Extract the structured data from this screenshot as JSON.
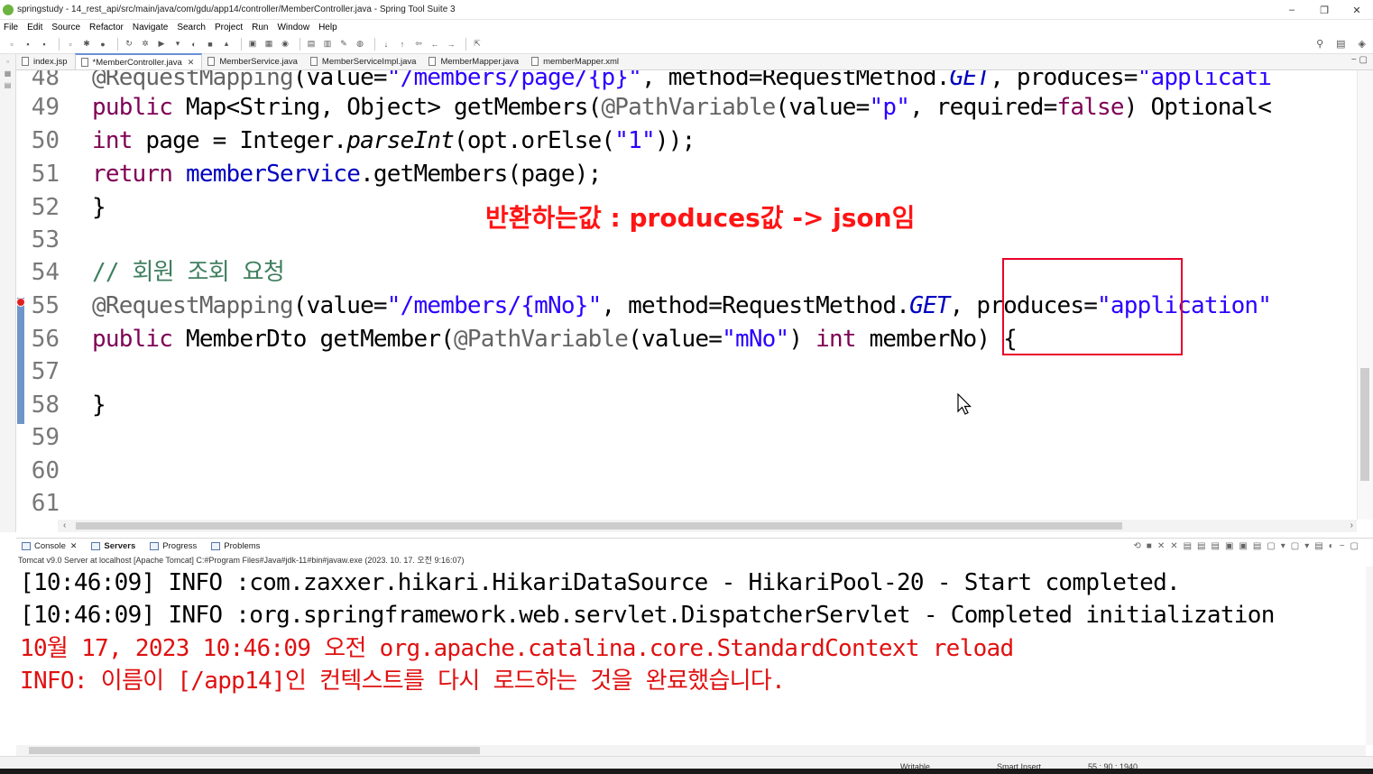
{
  "window": {
    "title": "springstudy - 14_rest_api/src/main/java/com/gdu/app14/controller/MemberController.java - Spring Tool Suite 3",
    "minimize": "–",
    "restore": "❐",
    "close": "✕"
  },
  "menu": [
    "File",
    "Edit",
    "Source",
    "Refactor",
    "Navigate",
    "Search",
    "Project",
    "Run",
    "Window",
    "Help"
  ],
  "editor_tabs": [
    {
      "label": "index.jsp",
      "active": false
    },
    {
      "label": "*MemberController.java",
      "active": true
    },
    {
      "label": "MemberService.java",
      "active": false
    },
    {
      "label": "MemberServiceImpl.java",
      "active": false
    },
    {
      "label": "MemberMapper.java",
      "active": false
    },
    {
      "label": "memberMapper.xml",
      "active": false
    }
  ],
  "code_lines": [
    {
      "num": "48",
      "text": "@RequestMapping(value=\"/members/page/{p}\", method=RequestMethod.GET, produces=\"applicati"
    },
    {
      "num": "49",
      "text": "public Map<String, Object> getMembers(@PathVariable(value=\"p\", required=false) Optional<"
    },
    {
      "num": "50",
      "text": "  int page = Integer.parseInt(opt.orElse(\"1\"));"
    },
    {
      "num": "51",
      "text": "  return memberService.getMembers(page);"
    },
    {
      "num": "52",
      "text": "}"
    },
    {
      "num": "53",
      "text": ""
    },
    {
      "num": "54",
      "text": "// 회원 조회 요청"
    },
    {
      "num": "55",
      "text": "@RequestMapping(value=\"/members/{mNo}\", method=RequestMethod.GET, produces=\"application\""
    },
    {
      "num": "56",
      "text": "public MemberDto getMember(@PathVariable(value=\"mNo\") int memberNo) {"
    },
    {
      "num": "57",
      "text": ""
    },
    {
      "num": "58",
      "text": "}"
    },
    {
      "num": "59",
      "text": ""
    },
    {
      "num": "60",
      "text": ""
    },
    {
      "num": "61",
      "text": ""
    }
  ],
  "annotation_text": "반환하는값 : produces값 -> json임",
  "panel_tabs": [
    {
      "label": "Console",
      "bold": false,
      "close": "✕"
    },
    {
      "label": "Servers",
      "bold": true
    },
    {
      "label": "Progress",
      "bold": false
    },
    {
      "label": "Problems",
      "bold": false
    }
  ],
  "console_description": "Tomcat v9.0 Server at localhost [Apache Tomcat] C:#Program Files#Java#jdk-11#bin#javaw.exe  (2023. 10. 17. 오전 9:16:07)",
  "console_lines": [
    {
      "text": "[10:46:09] INFO :com.zaxxer.hikari.HikariDataSource - HikariPool-20 - Start completed.",
      "kind": "info"
    },
    {
      "text": "[10:46:09] INFO :org.springframework.web.servlet.DispatcherServlet - Completed initialization",
      "kind": "info"
    },
    {
      "text": "10월 17, 2023 10:46:09 오전 org.apache.catalina.core.StandardContext reload",
      "kind": "err"
    },
    {
      "text": "INFO: 이름이 [/app14]인 컨텍스트를 다시 로드하는 것을 완료했습니다.",
      "kind": "err"
    }
  ],
  "status": {
    "writable": "Writable",
    "insert_mode": "Smart Insert",
    "position": "55 : 90 : 1940"
  },
  "colors": {
    "keyword": "#7f0055",
    "string": "#2a00ff",
    "annotation": "#646464",
    "field": "#0000c0",
    "comment": "#3f7f5f",
    "overlay": "#ff1414",
    "console_error": "#e01010"
  }
}
